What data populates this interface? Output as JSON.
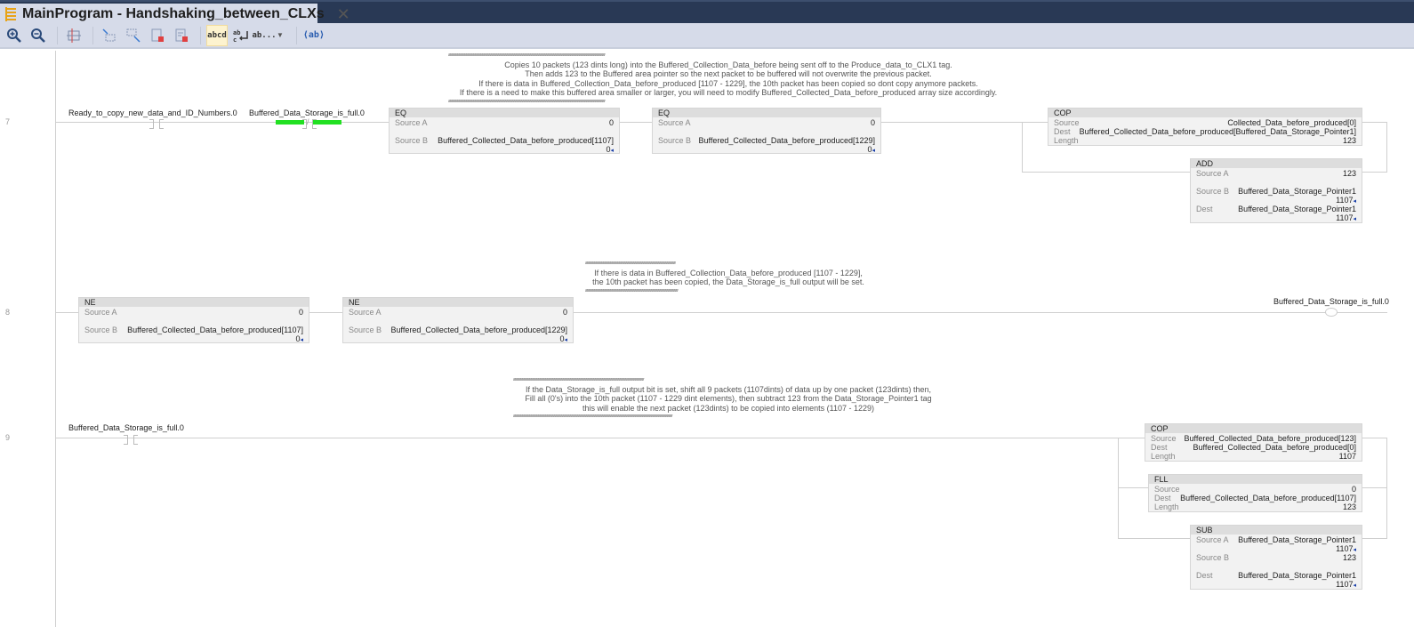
{
  "window": {
    "tab_title": "MainProgram - Handshaking_between_CLXs",
    "tab_icon": "ladder-routine-icon",
    "close_icon": "close-icon"
  },
  "toolbar": {
    "buttons": [
      {
        "name": "zoom-in-icon"
      },
      {
        "name": "zoom-out-icon"
      },
      {
        "name": "fit-layout-icon"
      },
      {
        "name": "add-rung-icon"
      },
      {
        "name": "edit-rung-icon"
      },
      {
        "name": "delete-rung-icon"
      },
      {
        "name": "delete-branch-icon"
      },
      {
        "name": "tag-description-toggle",
        "label": "abcd",
        "active": true
      },
      {
        "name": "wrap-text-toggle",
        "label": "ab c↵"
      },
      {
        "name": "truncate-text-dropdown",
        "label": "ab..."
      },
      {
        "name": "show-comments-toggle",
        "label": "⟨ab⟩"
      }
    ]
  },
  "rungs": [
    {
      "number": "7",
      "comment": [
        "Copies 10 packets (123 dints long) into the Buffered_Collection_Data_before being sent off to the Produce_data_to_CLX1 tag.",
        "Then adds 123 to the Buffered area pointer so the next packet to be buffered will not overwrite the previous packet.",
        "If there is data in Buffered_Collection_Data_before_produced [1107 - 1229], the 10th packet has been copied so dont copy anymore packets.",
        "If there is a need to make this buffered area smaller or larger, you will need to modify Buffered_Collected_Data_before_produced array size accordingly."
      ],
      "contacts": [
        {
          "type": "XIC",
          "tag": "Ready_to_copy_new_data_and_ID_Numbers.0",
          "energized": false
        },
        {
          "type": "XIO",
          "tag": "Buffered_Data_Storage_is_full.0",
          "energized": true
        }
      ],
      "instructions": [
        {
          "mnemonic": "EQ",
          "rows": [
            {
              "label": "Source A",
              "value": "0"
            },
            {
              "label": "Source B",
              "value": "Buffered_Collected_Data_before_produced[1107]",
              "live": "0"
            }
          ]
        },
        {
          "mnemonic": "EQ",
          "rows": [
            {
              "label": "Source A",
              "value": "0"
            },
            {
              "label": "Source B",
              "value": "Buffered_Collected_Data_before_produced[1229]",
              "live": "0"
            }
          ]
        },
        {
          "mnemonic": "COP",
          "rows": [
            {
              "label": "Source",
              "value": "Collected_Data_before_produced[0]"
            },
            {
              "label": "Dest",
              "value": "Buffered_Collected_Data_before_produced[Buffered_Data_Storage_Pointer1]"
            },
            {
              "label": "Length",
              "value": "123"
            }
          ]
        },
        {
          "mnemonic": "ADD",
          "rows": [
            {
              "label": "Source A",
              "value": "123"
            },
            {
              "label": "Source B",
              "value": "Buffered_Data_Storage_Pointer1",
              "live": "1107"
            },
            {
              "label": "Dest",
              "value": "Buffered_Data_Storage_Pointer1",
              "live": "1107"
            }
          ]
        }
      ]
    },
    {
      "number": "8",
      "comment": [
        "If there is data in Buffered_Collection_Data_before_produced [1107 - 1229],",
        "the 10th packet has been copied, the Data_Storage_is_full output will be set."
      ],
      "instructions": [
        {
          "mnemonic": "NE",
          "rows": [
            {
              "label": "Source A",
              "value": "0"
            },
            {
              "label": "Source B",
              "value": "Buffered_Collected_Data_before_produced[1107]",
              "live": "0"
            }
          ]
        },
        {
          "mnemonic": "NE",
          "rows": [
            {
              "label": "Source A",
              "value": "0"
            },
            {
              "label": "Source B",
              "value": "Buffered_Collected_Data_before_produced[1229]",
              "live": "0"
            }
          ]
        }
      ],
      "coil": {
        "type": "OTE",
        "tag": "Buffered_Data_Storage_is_full.0"
      }
    },
    {
      "number": "9",
      "comment": [
        "If the Data_Storage_is_full output bit is set, shift all 9 packets (1107dints) of data up by one packet (123dints) then,",
        "Fill all (0's) into the 10th packet (1107 - 1229 dint elements), then subtract 123 from the Data_Storage_Pointer1 tag",
        "this will enable the next packet (123dints) to be copied into elements (1107 - 1229)"
      ],
      "contacts": [
        {
          "type": "XIC",
          "tag": "Buffered_Data_Storage_is_full.0",
          "energized": false
        }
      ],
      "instructions": [
        {
          "mnemonic": "COP",
          "rows": [
            {
              "label": "Source",
              "value": "Buffered_Collected_Data_before_produced[123]"
            },
            {
              "label": "Dest",
              "value": "Buffered_Collected_Data_before_produced[0]"
            },
            {
              "label": "Length",
              "value": "1107"
            }
          ]
        },
        {
          "mnemonic": "FLL",
          "rows": [
            {
              "label": "Source",
              "value": "0"
            },
            {
              "label": "Dest",
              "value": "Buffered_Collected_Data_before_produced[1107]"
            },
            {
              "label": "Length",
              "value": "123"
            }
          ]
        },
        {
          "mnemonic": "SUB",
          "rows": [
            {
              "label": "Source A",
              "value": "Buffered_Data_Storage_Pointer1",
              "live": "1107"
            },
            {
              "label": "Source B",
              "value": "123"
            },
            {
              "label": "Dest",
              "value": "Buffered_Data_Storage_Pointer1",
              "live": "1107"
            }
          ]
        }
      ]
    }
  ],
  "colors": {
    "title_bar": "#293955",
    "tab_bg": "#d6dbe9",
    "energized": "#22e022",
    "live_value_arrow": "#1a3fa8",
    "instruction_bg": "#f2f2f2",
    "instruction_header": "#dddddd"
  }
}
